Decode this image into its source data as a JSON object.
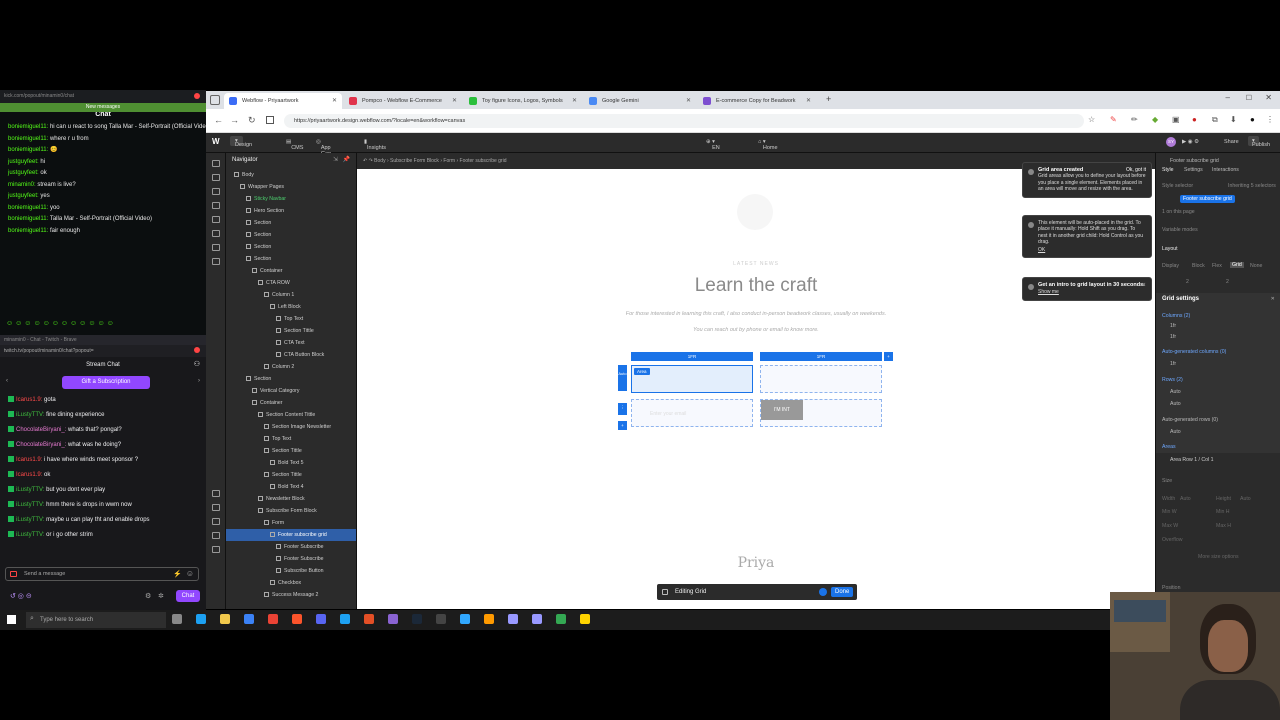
{
  "kick": {
    "url": "kick.com/popout/minamin0/chat",
    "new_messages": "New messages",
    "title": "Chat",
    "messages": [
      {
        "user": "boniemiguel11:",
        "text": "hi can u react to song Talla Mar - Self-Portrait (Official Video)"
      },
      {
        "user": "boniemiguel11:",
        "text": "where r u from"
      },
      {
        "user": "boniemiguel11:",
        "text": "😊"
      },
      {
        "user": "justguyfeet:",
        "text": "hi"
      },
      {
        "user": "justguyfeet:",
        "text": "ok"
      },
      {
        "user": "minamin0:",
        "text": "stream is live?"
      },
      {
        "user": "justguyfeet:",
        "text": "yes"
      },
      {
        "user": "boniemiguel11:",
        "text": "yoo"
      },
      {
        "user": "boniemiguel11:",
        "text": "Talla Mar - Self-Portrait (Official Video)"
      },
      {
        "user": "boniemiguel11:",
        "text": "fair enough"
      }
    ]
  },
  "twitch": {
    "window_title": "minamin0 - Chat - Twitch - Brave",
    "url": "twitch.tv/popout/minamin0/chat?popout=",
    "header": "Stream Chat",
    "gift_button": "Gift a Subscription",
    "messages": [
      {
        "user": "Icarus1.9:",
        "text": "gota",
        "color": "#ff4a4a"
      },
      {
        "user": "iLustyTTV:",
        "text": "fine dining experience",
        "color": "#3fbf3f"
      },
      {
        "user": "ChocolateBiryani_:",
        "text": "whats that? pongal?",
        "color": "#e67ad0"
      },
      {
        "user": "ChocolateBiryani_:",
        "text": "what was he doing?",
        "color": "#e67ad0"
      },
      {
        "user": "Icarus1.9:",
        "text": "i have where winds meet sponsor ?",
        "color": "#ff4a4a"
      },
      {
        "user": "Icarus1.9:",
        "text": "ok",
        "color": "#ff4a4a"
      },
      {
        "user": "iLustyTTV:",
        "text": "but you dont ever play",
        "color": "#3fbf3f"
      },
      {
        "user": "iLustyTTV:",
        "text": "hmm there is drops in wwm now",
        "color": "#3fbf3f"
      },
      {
        "user": "iLustyTTV:",
        "text": "maybe u can play tht and enable drops",
        "color": "#3fbf3f"
      },
      {
        "user": "iLustyTTV:",
        "text": "or i go other strim",
        "color": "#3fbf3f"
      }
    ],
    "input_placeholder": "Send a message",
    "chat_button": "Chat"
  },
  "browser": {
    "tabs": [
      {
        "label": "Webflow - Priyaartwork",
        "color": "#3b6cf6"
      },
      {
        "label": "Pompco - Webflow E-Commerce",
        "color": "#e0334b"
      },
      {
        "label": "Toy figure Icons, Logos, Symbols",
        "color": "#2bbf3c"
      },
      {
        "label": "Google Gemini",
        "color": "#4a8af4"
      },
      {
        "label": "E-commerce Copy for Beadwork",
        "color": "#7d4fd0"
      }
    ],
    "url": "https://priyaartwork.design.webflow.com/?locale=en&workflow=canvas"
  },
  "webflow": {
    "topbar": {
      "design": "Design",
      "cms": "CMS",
      "app_gen": "App Gen",
      "insights": "Insights",
      "locale": "EN",
      "page": "Home",
      "share": "Share",
      "publish": "Publish"
    },
    "navigator_title": "Navigator",
    "breadcrumb": [
      "Body",
      "Subscribe Form Block",
      "Form",
      "Footer subscribe grid"
    ],
    "nav_items": [
      {
        "label": "Body",
        "indent": 0
      },
      {
        "label": "Wrapper Pages",
        "indent": 1
      },
      {
        "label": "Sticky Navbar",
        "indent": 2,
        "green": true
      },
      {
        "label": "Hero Section",
        "indent": 2
      },
      {
        "label": "Section",
        "indent": 2
      },
      {
        "label": "Section",
        "indent": 2
      },
      {
        "label": "Section",
        "indent": 2
      },
      {
        "label": "Section",
        "indent": 2
      },
      {
        "label": "Container",
        "indent": 3
      },
      {
        "label": "CTA ROW",
        "indent": 4
      },
      {
        "label": "Column 1",
        "indent": 5
      },
      {
        "label": "Left Block",
        "indent": 6
      },
      {
        "label": "Top Text",
        "indent": 7
      },
      {
        "label": "Section Tittle",
        "indent": 7
      },
      {
        "label": "CTA Text",
        "indent": 7
      },
      {
        "label": "CTA Button Block",
        "indent": 7
      },
      {
        "label": "Column 2",
        "indent": 5
      },
      {
        "label": "Section",
        "indent": 2
      },
      {
        "label": "Vertical Category",
        "indent": 3
      },
      {
        "label": "Container",
        "indent": 3
      },
      {
        "label": "Section Content Tittle",
        "indent": 4
      },
      {
        "label": "Section Image Newsletter",
        "indent": 5
      },
      {
        "label": "Top Text",
        "indent": 5
      },
      {
        "label": "Section Tittle",
        "indent": 5
      },
      {
        "label": "Bold Text 5",
        "indent": 6
      },
      {
        "label": "Section Tittle",
        "indent": 5
      },
      {
        "label": "Bold Text 4",
        "indent": 6
      },
      {
        "label": "Newsletter Block",
        "indent": 4
      },
      {
        "label": "Subscribe Form Block",
        "indent": 4
      },
      {
        "label": "Form",
        "indent": 5
      },
      {
        "label": "Footer subscribe grid",
        "indent": 6,
        "selected": true
      },
      {
        "label": "Footer Subscribe",
        "indent": 7
      },
      {
        "label": "Footer Subscribe",
        "indent": 7
      },
      {
        "label": "Subscribe Button",
        "indent": 7
      },
      {
        "label": "Checkbox",
        "indent": 6
      },
      {
        "label": "Success Message 2",
        "indent": 5
      }
    ],
    "canvas": {
      "eyebrow": "LATEST NEWS",
      "heading": "Learn the craft",
      "para1": "For those interested in learning this craft, I also conduct in-person beadwork classes, usually on weekends.",
      "para2": "You can reach out by phone or email to know more.",
      "col1": "1FR",
      "col2": "1FR",
      "row_label": "Auto",
      "area_label": "Area",
      "field_placeholder": "Enter your email",
      "button_text": "I'M INT",
      "footer_logo": "Priya",
      "editing_label": "Editing Grid",
      "done_button": "Done"
    },
    "toasts": [
      {
        "title": "Grid area created",
        "action": "Ok, got it",
        "body": "Grid areas allow you to define your layout before you place a single element. Elements placed in an area will move and resize with the area."
      },
      {
        "title": "",
        "action": "",
        "body": "This element will be auto-placed in the grid. To place it manually: Hold Shift as you drag. To nest it in another grid child: Hold Control as you drag.",
        "link": "OK"
      },
      {
        "title": "Get an intro to grid layout in 30 seconds.",
        "action": "",
        "body": "",
        "link": "Show me"
      }
    ],
    "right_panel": {
      "selector": "Footer subscribe grid",
      "tabs": [
        "Style",
        "Settings",
        "Interactions"
      ],
      "style_selector": "Style selector",
      "inheriting": "Inheriting 5 selectors",
      "class_chip": "Footer subscribe grid",
      "on_page": "1 on this page",
      "variable_modes": "Variable modes",
      "layout": "Layout",
      "display": "Display",
      "display_options": [
        "Block",
        "Flex",
        "Grid",
        "None"
      ],
      "grid_settings": "Grid settings",
      "columns": "Columns (2)",
      "col_vals": [
        "1fr",
        "1fr"
      ],
      "auto_cols": "Auto-generated columns (0)",
      "auto_col_val": "1fr",
      "rows": "Rows (2)",
      "row_vals": [
        "Auto",
        "Auto"
      ],
      "auto_rows": "Auto-generated rows (0)",
      "auto_row_val": "Auto",
      "areas": "Areas",
      "area_item": "Area Row 1 / Col 1",
      "size": "Size",
      "width": "Width",
      "height": "Height",
      "auto": "Auto",
      "min_w": "Min W",
      "min_h": "Min H",
      "max_w": "Max W",
      "max_h": "Max H",
      "overflow": "Overflow",
      "more_size": "More size options",
      "position": "Position",
      "grid_gap_1": "2",
      "grid_gap_2": "2"
    }
  },
  "taskbar": {
    "search_placeholder": "Type here to search"
  }
}
